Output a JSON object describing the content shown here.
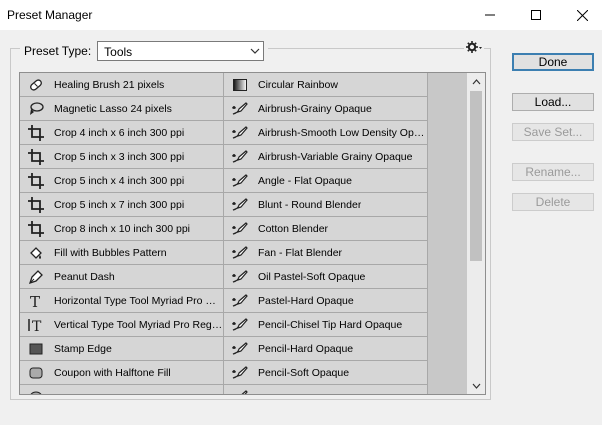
{
  "window": {
    "title": "Preset Manager"
  },
  "preset_type": {
    "label": "Preset Type:",
    "value": "Tools"
  },
  "colors": {
    "accent": "#3c7fb1",
    "list_bg": "#d6d6d6"
  },
  "presets_left": [
    {
      "label": "Healing Brush 21 pixels",
      "icon": "healing-brush-icon"
    },
    {
      "label": "Magnetic Lasso 24 pixels",
      "icon": "magnetic-lasso-icon"
    },
    {
      "label": "Crop 4 inch x 6 inch 300 ppi",
      "icon": "crop-icon"
    },
    {
      "label": "Crop 5 inch x 3 inch 300 ppi",
      "icon": "crop-icon"
    },
    {
      "label": "Crop 5 inch x 4 inch 300 ppi",
      "icon": "crop-icon"
    },
    {
      "label": "Crop 5 inch x 7 inch 300 ppi",
      "icon": "crop-icon"
    },
    {
      "label": "Crop 8 inch x 10 inch 300 ppi",
      "icon": "crop-icon"
    },
    {
      "label": "Fill with Bubbles Pattern",
      "icon": "paint-bucket-icon"
    },
    {
      "label": "Peanut Dash",
      "icon": "pen-icon"
    },
    {
      "label": "Horizontal Type Tool Myriad Pro Re...",
      "icon": "type-icon"
    },
    {
      "label": "Vertical Type Tool Myriad Pro Regu...",
      "icon": "vertical-type-icon"
    },
    {
      "label": "Stamp Edge",
      "icon": "rectangle-icon"
    },
    {
      "label": "Coupon with Halftone Fill",
      "icon": "rounded-rectangle-icon"
    },
    {
      "label": "",
      "icon": "ellipse-icon"
    }
  ],
  "presets_right": [
    {
      "label": "Circular Rainbow",
      "icon": "gradient-icon"
    },
    {
      "label": "Airbrush-Grainy Opaque",
      "icon": "mixer-brush-icon"
    },
    {
      "label": "Airbrush-Smooth Low Density Opa...",
      "icon": "mixer-brush-icon"
    },
    {
      "label": "Airbrush-Variable Grainy Opaque",
      "icon": "mixer-brush-icon"
    },
    {
      "label": "Angle - Flat Opaque",
      "icon": "mixer-brush-icon"
    },
    {
      "label": "Blunt - Round Blender",
      "icon": "mixer-brush-icon"
    },
    {
      "label": "Cotton Blender",
      "icon": "mixer-brush-icon"
    },
    {
      "label": "Fan - Flat Blender",
      "icon": "mixer-brush-icon"
    },
    {
      "label": "Oil Pastel-Soft Opaque",
      "icon": "mixer-brush-icon"
    },
    {
      "label": "Pastel-Hard Opaque",
      "icon": "mixer-brush-icon"
    },
    {
      "label": "Pencil-Chisel Tip Hard Opaque",
      "icon": "mixer-brush-icon"
    },
    {
      "label": "Pencil-Hard Opaque",
      "icon": "mixer-brush-icon"
    },
    {
      "label": "Pencil-Soft Opaque",
      "icon": "mixer-brush-icon"
    },
    {
      "label": "",
      "icon": "mixer-brush-icon"
    }
  ],
  "buttons": {
    "done": "Done",
    "load": "Load...",
    "save_set": "Save Set...",
    "rename": "Rename...",
    "delete": "Delete"
  }
}
